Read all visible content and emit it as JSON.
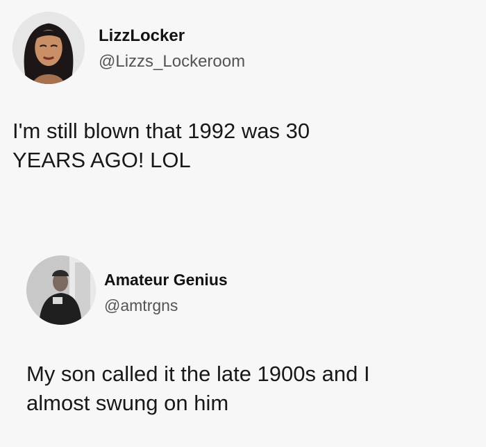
{
  "tweets": [
    {
      "display_name": "LizzLocker",
      "handle": "@Lizzs_Lockeroom",
      "line1": "I'm still blown that 1992 was 30",
      "line2": "YEARS AGO! LOL"
    },
    {
      "display_name": "Amateur Genius",
      "handle": "@amtrgns",
      "line1": "My son called it the late 1900s and I",
      "line2": "almost swung on him"
    }
  ]
}
